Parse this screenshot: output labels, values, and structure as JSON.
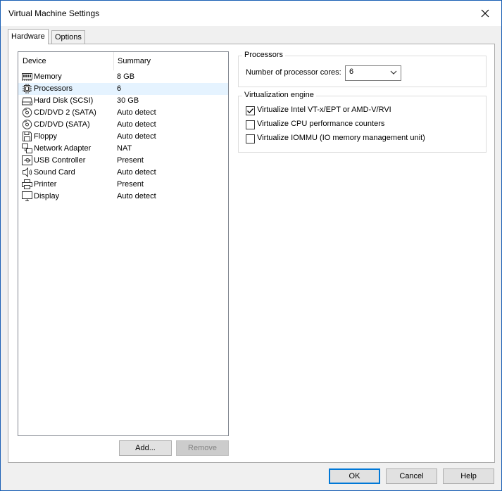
{
  "window": {
    "title": "Virtual Machine Settings"
  },
  "tabs": [
    {
      "label": "Hardware",
      "active": true
    },
    {
      "label": "Options",
      "active": false
    }
  ],
  "device_list": {
    "columns": [
      "Device",
      "Summary"
    ],
    "rows": [
      {
        "device": "Memory",
        "summary": "8 GB",
        "icon": "memory-icon"
      },
      {
        "device": "Processors",
        "summary": "6",
        "icon": "processor-icon",
        "selected": true
      },
      {
        "device": "Hard Disk (SCSI)",
        "summary": "30 GB",
        "icon": "hard-disk-icon"
      },
      {
        "device": "CD/DVD 2 (SATA)",
        "summary": "Auto detect",
        "icon": "cd-dvd-icon"
      },
      {
        "device": "CD/DVD (SATA)",
        "summary": "Auto detect",
        "icon": "cd-dvd-icon"
      },
      {
        "device": "Floppy",
        "summary": "Auto detect",
        "icon": "floppy-icon"
      },
      {
        "device": "Network Adapter",
        "summary": "NAT",
        "icon": "network-adapter-icon"
      },
      {
        "device": "USB Controller",
        "summary": "Present",
        "icon": "usb-icon"
      },
      {
        "device": "Sound Card",
        "summary": "Auto detect",
        "icon": "speaker-icon"
      },
      {
        "device": "Printer",
        "summary": "Present",
        "icon": "printer-icon"
      },
      {
        "device": "Display",
        "summary": "Auto detect",
        "icon": "monitor-icon"
      }
    ]
  },
  "list_buttons": {
    "add": "Add...",
    "remove": "Remove"
  },
  "processors": {
    "group_title": "Processors",
    "cores_label": "Number of processor cores:",
    "cores_value": "6"
  },
  "virtualization": {
    "group_title": "Virtualization engine",
    "options": [
      {
        "label": "Virtualize Intel VT-x/EPT or AMD-V/RVI",
        "checked": true
      },
      {
        "label": "Virtualize CPU performance counters",
        "checked": false
      },
      {
        "label": "Virtualize IOMMU (IO memory management unit)",
        "checked": false
      }
    ]
  },
  "footer": {
    "ok": "OK",
    "cancel": "Cancel",
    "help": "Help"
  },
  "colors": {
    "accent": "#0078d7",
    "selected_row": "#e5f3ff",
    "window_border": "#1a5fb4"
  }
}
